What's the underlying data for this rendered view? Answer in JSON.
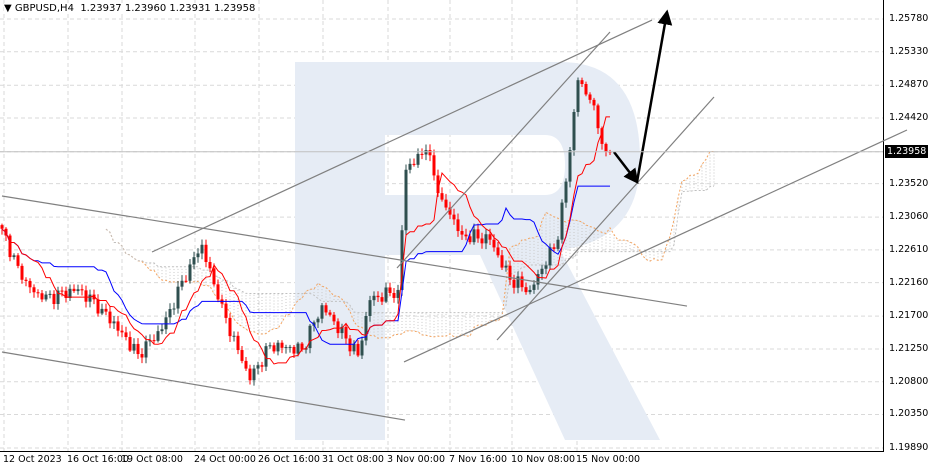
{
  "header": {
    "symbol": "GBPUSD,H4",
    "open": "1.23937",
    "high": "1.23960",
    "low": "1.23931",
    "close": "1.23958"
  },
  "colors": {
    "bull": "#2f4f4f",
    "bear": "#ff0000",
    "kijun": "#0000ff",
    "tenkan": "#ff0000",
    "cloud": "#f4a460",
    "grid": "#d9d9d9",
    "watermark": "#e6ecf5"
  },
  "chart_data": {
    "type": "candlestick",
    "title": "GBPUSD,H4",
    "current_price": "1.23958",
    "ylim": [
      1.1989,
      1.2578
    ],
    "y_ticks": [
      "1.25780",
      "1.25330",
      "1.24870",
      "1.24420",
      "1.23958",
      "1.23520",
      "1.23060",
      "1.22610",
      "1.22160",
      "1.21700",
      "1.21250",
      "1.20800",
      "1.20350",
      "1.19890"
    ],
    "x_ticks": [
      {
        "label": "12 Oct 2023",
        "i": 0.5
      },
      {
        "label": "16 Oct 16:00",
        "i": 16.5
      },
      {
        "label": "19 Oct 08:00",
        "i": 30
      },
      {
        "label": "24 Oct 00:00",
        "i": 48.25
      },
      {
        "label": "26 Oct 16:00",
        "i": 64.25
      },
      {
        "label": "31 Oct 08:00",
        "i": 80.25
      },
      {
        "label": "3 Nov 00:00",
        "i": 96.5
      },
      {
        "label": "7 Nov 16:00",
        "i": 112
      },
      {
        "label": "10 Nov 08:00",
        "i": 127.5
      },
      {
        "label": "15 Nov 00:00",
        "i": 143.75
      }
    ],
    "close_waypoints": [
      [
        0,
        1.229
      ],
      [
        5,
        1.222
      ],
      [
        10,
        1.2193
      ],
      [
        19,
        1.2207
      ],
      [
        25,
        1.218
      ],
      [
        34,
        1.2118
      ],
      [
        40,
        1.2152
      ],
      [
        47,
        1.2241
      ],
      [
        50,
        1.2268
      ],
      [
        54,
        1.2193
      ],
      [
        62,
        1.2082
      ],
      [
        67,
        1.213
      ],
      [
        75,
        1.2124
      ],
      [
        80,
        1.2185
      ],
      [
        89,
        1.2116
      ],
      [
        92,
        1.2192
      ],
      [
        99,
        1.2206
      ],
      [
        101,
        1.2371
      ],
      [
        106,
        1.2398
      ],
      [
        110,
        1.233
      ],
      [
        115,
        1.2282
      ],
      [
        122,
        1.2275
      ],
      [
        127,
        1.222
      ],
      [
        132,
        1.2206
      ],
      [
        139,
        1.2275
      ],
      [
        142,
        1.2398
      ],
      [
        144,
        1.2494
      ],
      [
        147,
        1.2467
      ],
      [
        151,
        1.2396
      ],
      [
        152,
        1.23958
      ]
    ],
    "lines": [
      [
        [
          37.5,
          1.22581
        ],
        [
          162.5,
          1.25766
        ]
      ],
      [
        [
          98.75,
          1.22361
        ],
        [
          152,
          1.25602
        ]
      ],
      [
        [
          123.75,
          1.21373
        ],
        [
          178,
          1.24709
        ]
      ],
      [
        [
          100.5,
          1.21071
        ],
        [
          226.25,
          1.24256
        ]
      ],
      [
        [
          0,
          1.2335
        ],
        [
          171.25,
          1.21839
        ]
      ],
      [
        [
          0,
          1.21208
        ],
        [
          100.75,
          1.20274
        ]
      ]
    ],
    "arrows": [
      [
        [
          153,
          1.23954
        ],
        [
          158.75,
          1.23542
        ]
      ],
      [
        [
          158.75,
          1.23542
        ],
        [
          166.25,
          1.25876
        ]
      ]
    ]
  }
}
